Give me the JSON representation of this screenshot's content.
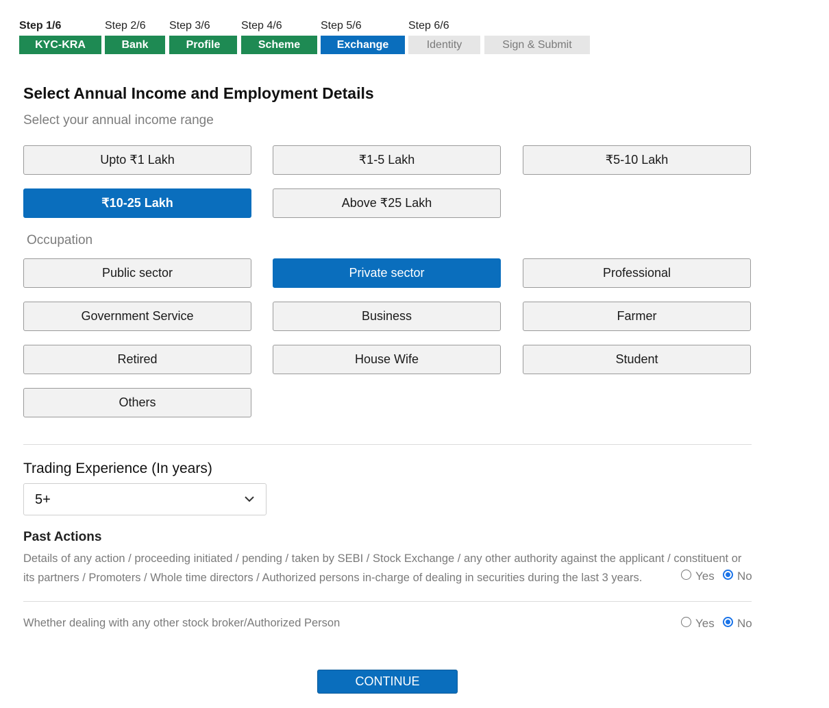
{
  "stepper": {
    "steps": [
      {
        "step": "Step 1/6",
        "label": "KYC-KRA",
        "state": "done"
      },
      {
        "step": "Step 2/6",
        "label": "Bank",
        "state": "done"
      },
      {
        "step": "Step 3/6",
        "label": "Profile",
        "state": "done"
      },
      {
        "step": "Step 4/6",
        "label": "Scheme",
        "state": "done"
      },
      {
        "step": "Step 5/6",
        "label": "Exchange",
        "state": "active"
      },
      {
        "step": "Step 6/6",
        "label": "Identity",
        "state": "todo"
      },
      {
        "step": "",
        "label": "Sign & Submit",
        "state": "todo"
      }
    ]
  },
  "page": {
    "title": "Select Annual Income and Employment Details",
    "income_prompt": "Select your annual income range"
  },
  "income": {
    "options": [
      "Upto ₹1 Lakh",
      "₹1-5 Lakh",
      "₹5-10 Lakh",
      "₹10-25 Lakh",
      "Above ₹25 Lakh"
    ],
    "selected": "₹10-25 Lakh"
  },
  "occupation": {
    "heading": "Occupation",
    "options": [
      "Public sector",
      "Private sector",
      "Professional",
      "Government Service",
      "Business",
      "Farmer",
      "Retired",
      "House Wife",
      "Student",
      "Others"
    ],
    "selected": "Private sector"
  },
  "trading": {
    "heading": "Trading Experience (In years)",
    "value": "5+"
  },
  "past_actions": {
    "heading": "Past Actions",
    "text": "Details of any action / proceeding initiated / pending / taken by SEBI / Stock Exchange / any other authority against the applicant / constituent or its partners / Promoters / Whole time directors / Authorized persons in-charge of dealing in securities during the last 3 years.",
    "yes_label": "Yes",
    "no_label": "No",
    "selected": "No"
  },
  "other_broker": {
    "text": "Whether dealing with any other stock broker/Authorized Person",
    "yes_label": "Yes",
    "no_label": "No",
    "selected": "No"
  },
  "continue_label": "CONTINUE",
  "colors": {
    "done": "#1e8a53",
    "active": "#0a6ebd",
    "todo": "#e6e6e6",
    "radio": "#1a73e8"
  }
}
